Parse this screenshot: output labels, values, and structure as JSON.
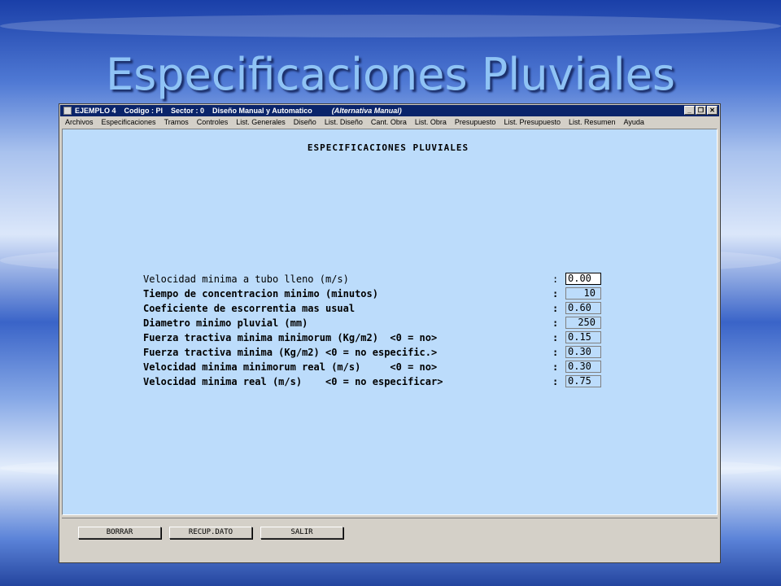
{
  "slide": {
    "title": "Especificaciones Pluviales"
  },
  "window": {
    "titlebar": {
      "project": "EJEMPLO 4",
      "codigo": "Codigo : PI",
      "sector": "Sector : 0",
      "mode": "Diseño Manual y Automatico",
      "alternative": "(Alternativa Manual)"
    },
    "controls": {
      "minimize": "_",
      "restore": "❐",
      "close": "✕"
    },
    "menu": [
      "Archivos",
      "Especificaciones",
      "Tramos",
      "Controles",
      "List. Generales",
      "Diseño",
      "List. Diseño",
      "Cant. Obra",
      "List. Obra",
      "Presupuesto",
      "List. Presupuesto",
      "List. Resumen",
      "Ayuda"
    ]
  },
  "form": {
    "heading": "ESPECIFICACIONES PLUVIALES",
    "fields": [
      {
        "label": "Velocidad minima a tubo lleno (m/s)",
        "colon": ":",
        "value": "0.00"
      },
      {
        "label": "Tiempo de concentracion minimo (minutos)",
        "colon": ":",
        "value": "10"
      },
      {
        "label": "Coeficiente de escorrentia mas usual",
        "colon": ":",
        "value": "0.60"
      },
      {
        "label": "Diametro minimo pluvial (mm)",
        "colon": ":",
        "value": "250"
      },
      {
        "label": "Fuerza tractiva minima minimorum (Kg/m2)  <0 = no>",
        "colon": ":",
        "value": "0.15"
      },
      {
        "label": "Fuerza tractiva minima (Kg/m2) <0 = no especific.>",
        "colon": ":",
        "value": "0.30"
      },
      {
        "label": "Velocidad minima minimorum real (m/s)     <0 = no>",
        "colon": ":",
        "value": "0.30"
      },
      {
        "label": "Velocidad minima real (m/s)    <0 = no especificar>",
        "colon": ":",
        "value": "0.75"
      }
    ]
  },
  "buttons": {
    "borrar": "BORRAR",
    "recup": "RECUP.DATO",
    "salir": "SALIR"
  }
}
